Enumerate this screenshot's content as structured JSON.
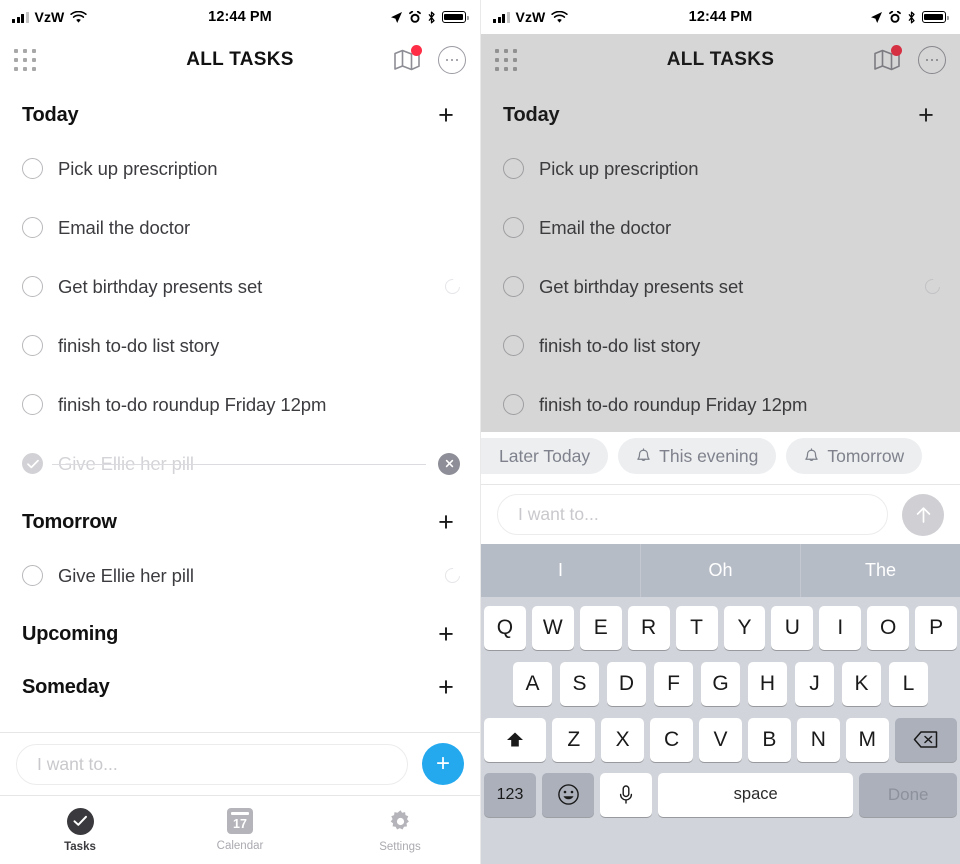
{
  "statusbar": {
    "carrier": "VzW",
    "time": "12:44 PM",
    "icons": [
      "signal-bars-icon",
      "wifi-icon",
      "location-arrow-icon",
      "alarm-clock-icon",
      "bluetooth-icon",
      "battery-icon"
    ]
  },
  "navbar": {
    "title": "ALL TASKS",
    "grid_icon": "grid-menu-icon",
    "map_icon": "map-icon",
    "badge": "notification-dot",
    "more_icon": "more-options-icon"
  },
  "sections": [
    {
      "title": "Today",
      "add_label": "+",
      "tasks": [
        {
          "text": "Pick up prescription",
          "done": false,
          "repeat": false
        },
        {
          "text": "Email the doctor",
          "done": false,
          "repeat": false
        },
        {
          "text": "Get birthday presents set",
          "done": false,
          "repeat": true
        },
        {
          "text": "finish to-do list story",
          "done": false,
          "repeat": false
        },
        {
          "text": "finish to-do roundup Friday 12pm",
          "done": false,
          "repeat": false
        },
        {
          "text": "Give Ellie her pill",
          "done": true,
          "repeat": false
        }
      ]
    },
    {
      "title": "Tomorrow",
      "add_label": "+",
      "tasks": [
        {
          "text": "Give Ellie her pill",
          "done": false,
          "repeat": true
        }
      ]
    },
    {
      "title": "Upcoming",
      "add_label": "+",
      "tasks": []
    },
    {
      "title": "Someday",
      "add_label": "+",
      "tasks": []
    }
  ],
  "composer": {
    "placeholder": "I want to...",
    "value": "",
    "add_button": "+",
    "send_icon": "arrow-up-icon"
  },
  "tabbar": {
    "tabs": [
      {
        "label": "Tasks",
        "icon": "check-circle-icon",
        "active": true
      },
      {
        "label": "Calendar",
        "icon": "calendar-icon",
        "day": "17",
        "active": false
      },
      {
        "label": "Settings",
        "icon": "gear-icon",
        "active": false
      }
    ]
  },
  "suggestion_chips": [
    {
      "label": "Later Today",
      "icon": null,
      "cut_off": true
    },
    {
      "label": "This evening",
      "icon": "bell-icon",
      "cut_off": false
    },
    {
      "label": "Tomorrow",
      "icon": "bell-icon",
      "cut_off": false
    }
  ],
  "keyboard": {
    "predictive": [
      "I",
      "Oh",
      "The"
    ],
    "row1": [
      "Q",
      "W",
      "E",
      "R",
      "T",
      "Y",
      "U",
      "I",
      "O",
      "P"
    ],
    "row2": [
      "A",
      "S",
      "D",
      "F",
      "G",
      "H",
      "J",
      "K",
      "L"
    ],
    "row3": [
      "Z",
      "X",
      "C",
      "V",
      "B",
      "N",
      "M"
    ],
    "shift_key": "shift-icon",
    "backspace_key": "backspace-icon",
    "numeric_key": "123",
    "emoji_key": "emoji-icon",
    "mic_key": "microphone-icon",
    "space_key": "space",
    "done_key": "Done"
  },
  "colors": {
    "accent_blue": "#24a9ef",
    "badge_red": "#ff2d45",
    "keyboard_bg": "#d1d4db",
    "predictive_bg": "#b6bcc6",
    "dim_overlay": "rgba(60,60,60,0.21)"
  }
}
